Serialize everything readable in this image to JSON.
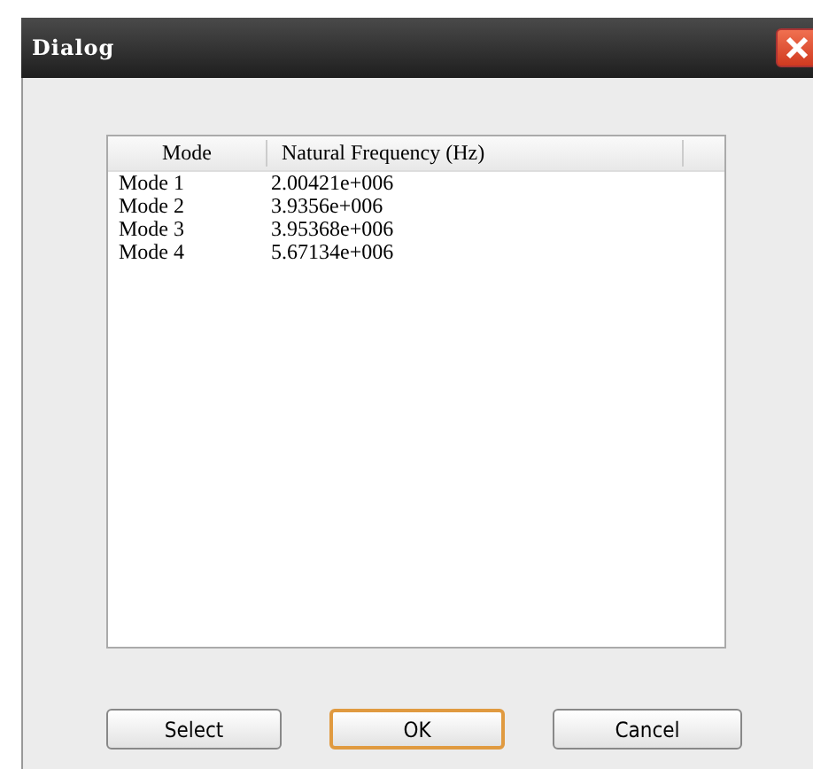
{
  "window": {
    "title": "Dialog"
  },
  "table": {
    "columns": [
      "Mode",
      "Natural Frequency (Hz)"
    ],
    "rows": [
      [
        "Mode 1",
        "2.00421e+006"
      ],
      [
        "Mode 2",
        "3.9356e+006"
      ],
      [
        "Mode 3",
        "3.95368e+006"
      ],
      [
        "Mode 4",
        "5.67134e+006"
      ]
    ]
  },
  "buttons": [
    {
      "label": "Select",
      "default": false
    },
    {
      "label": "OK",
      "default": true
    },
    {
      "label": "Cancel",
      "default": false
    }
  ]
}
